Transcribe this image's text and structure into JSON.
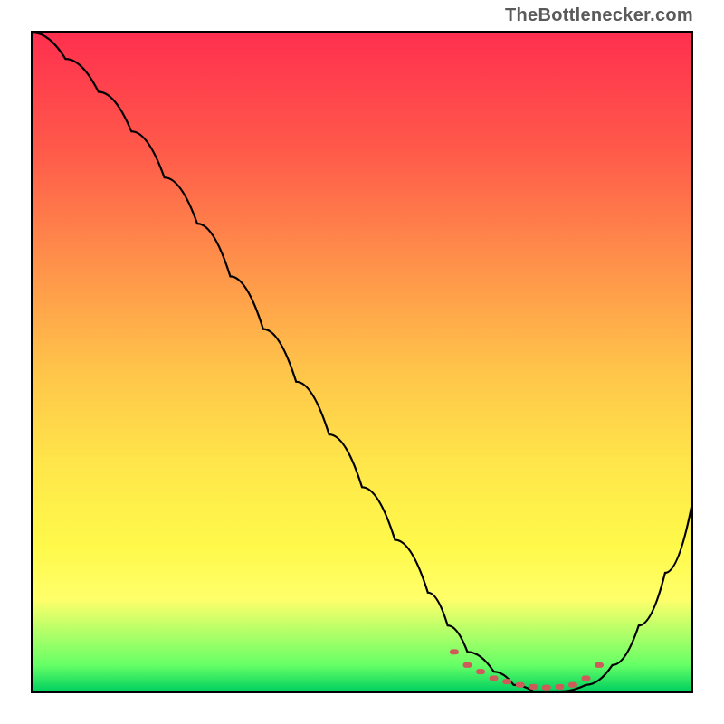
{
  "watermark": {
    "text": "TheBottlenecker.com"
  },
  "chart_data": {
    "type": "line",
    "title": "",
    "xlabel": "",
    "ylabel": "",
    "xlim": [
      0,
      100
    ],
    "ylim": [
      0,
      100
    ],
    "grid": false,
    "legend": false,
    "series": [
      {
        "name": "bottleneck-curve",
        "color": "#000000",
        "x": [
          0,
          5,
          10,
          15,
          20,
          25,
          30,
          35,
          40,
          45,
          50,
          55,
          60,
          63,
          66,
          70,
          73,
          76,
          80,
          84,
          88,
          92,
          96,
          100
        ],
        "y": [
          100,
          96,
          91,
          85,
          78,
          71,
          63,
          55,
          47,
          39,
          31,
          23,
          15,
          10,
          6,
          3,
          1,
          0,
          0,
          1,
          4,
          10,
          18,
          28
        ]
      }
    ],
    "markers": {
      "name": "flat-bottom-markers",
      "color": "#cf5a5a",
      "x": [
        64,
        66,
        68,
        70,
        72,
        74,
        76,
        78,
        80,
        82,
        84,
        86
      ],
      "y": [
        6,
        4,
        3,
        2,
        1.5,
        1,
        0.7,
        0.6,
        0.7,
        1,
        2,
        4
      ]
    },
    "gradient_stops": [
      {
        "pos": 0.0,
        "color": "#ff2f4f"
      },
      {
        "pos": 0.18,
        "color": "#ff5a4a"
      },
      {
        "pos": 0.36,
        "color": "#ff944a"
      },
      {
        "pos": 0.52,
        "color": "#ffc64a"
      },
      {
        "pos": 0.66,
        "color": "#ffe74a"
      },
      {
        "pos": 0.78,
        "color": "#fff94a"
      },
      {
        "pos": 0.86,
        "color": "#ffff6a"
      },
      {
        "pos": 0.96,
        "color": "#66ff66"
      },
      {
        "pos": 1.0,
        "color": "#00d060"
      }
    ]
  }
}
